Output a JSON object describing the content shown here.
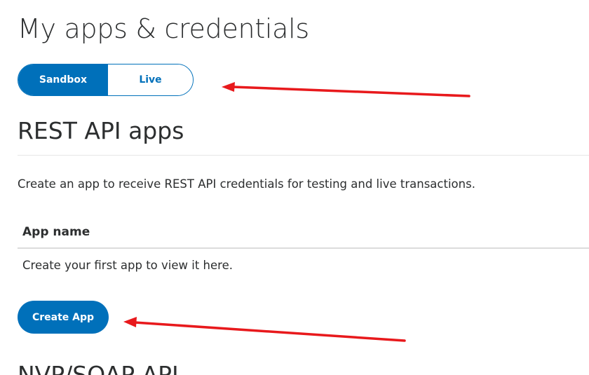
{
  "page": {
    "title": "My apps & credentials"
  },
  "environment_toggle": {
    "options": [
      {
        "label": "Sandbox",
        "selected": true
      },
      {
        "label": "Live",
        "selected": false
      }
    ]
  },
  "rest_api_section": {
    "heading": "REST API apps",
    "description": "Create an app to receive REST API credentials for testing and live transactions.",
    "table": {
      "column_header": "App name",
      "empty_message": "Create your first app to view it here."
    },
    "create_button_label": "Create App"
  },
  "next_section": {
    "heading": "NVP/SOAP API"
  },
  "colors": {
    "brand_blue": "#0070ba",
    "annotation_red": "#e8191c",
    "text": "#2c2e2f"
  }
}
